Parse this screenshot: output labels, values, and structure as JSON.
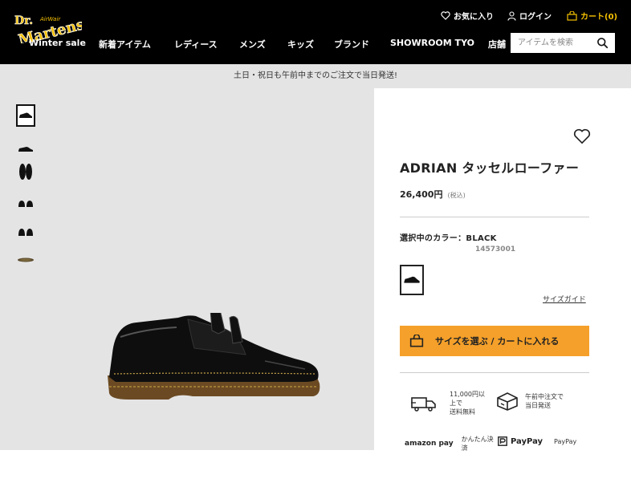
{
  "header": {
    "logo_text": "Dr. Martens",
    "logo_sub": "AirWair",
    "favorites_label": "お気に入り",
    "login_label": "ログイン",
    "cart_label": "カート(0)",
    "nav": [
      {
        "label": "Winter sale"
      },
      {
        "label": "新着アイテム"
      },
      {
        "label": "レディース"
      },
      {
        "label": "メンズ"
      },
      {
        "label": "キッズ"
      },
      {
        "label": "ブランド"
      },
      {
        "label": "SHOWROOM TYO"
      },
      {
        "label": "店舗"
      }
    ],
    "search_placeholder": "アイテムを検索"
  },
  "notice": "土日・祝日も午前中までのご注文で当日発送!",
  "product": {
    "title": "ADRIAN タッセルローファー",
    "price": "26,400円",
    "tax_note": "(税込)",
    "color_label": "選択中のカラー：BLACK",
    "sku": "14573001",
    "size_guide": "サイズガイド",
    "cta_label": "サイズを選ぶ / カートに入れる"
  },
  "features": [
    {
      "icon": "truck-icon",
      "text_line1": "11,000円以",
      "text_line2": "上で",
      "text_line3": "送料無料"
    },
    {
      "icon": "box-icon",
      "text_line1": "午前中注文で",
      "text_line2": "当日発送",
      "text_line3": ""
    }
  ],
  "payments": {
    "amazon_logo": "amazon pay",
    "amazon_text": "かんたん決済",
    "paypay_logo": "PayPay",
    "paypay_text": "PayPay"
  },
  "colors": {
    "accent": "#f5a02a",
    "cart_yellow": "#f5c000",
    "header_bg": "#000000",
    "gallery_bg": "#e4e4e4"
  }
}
